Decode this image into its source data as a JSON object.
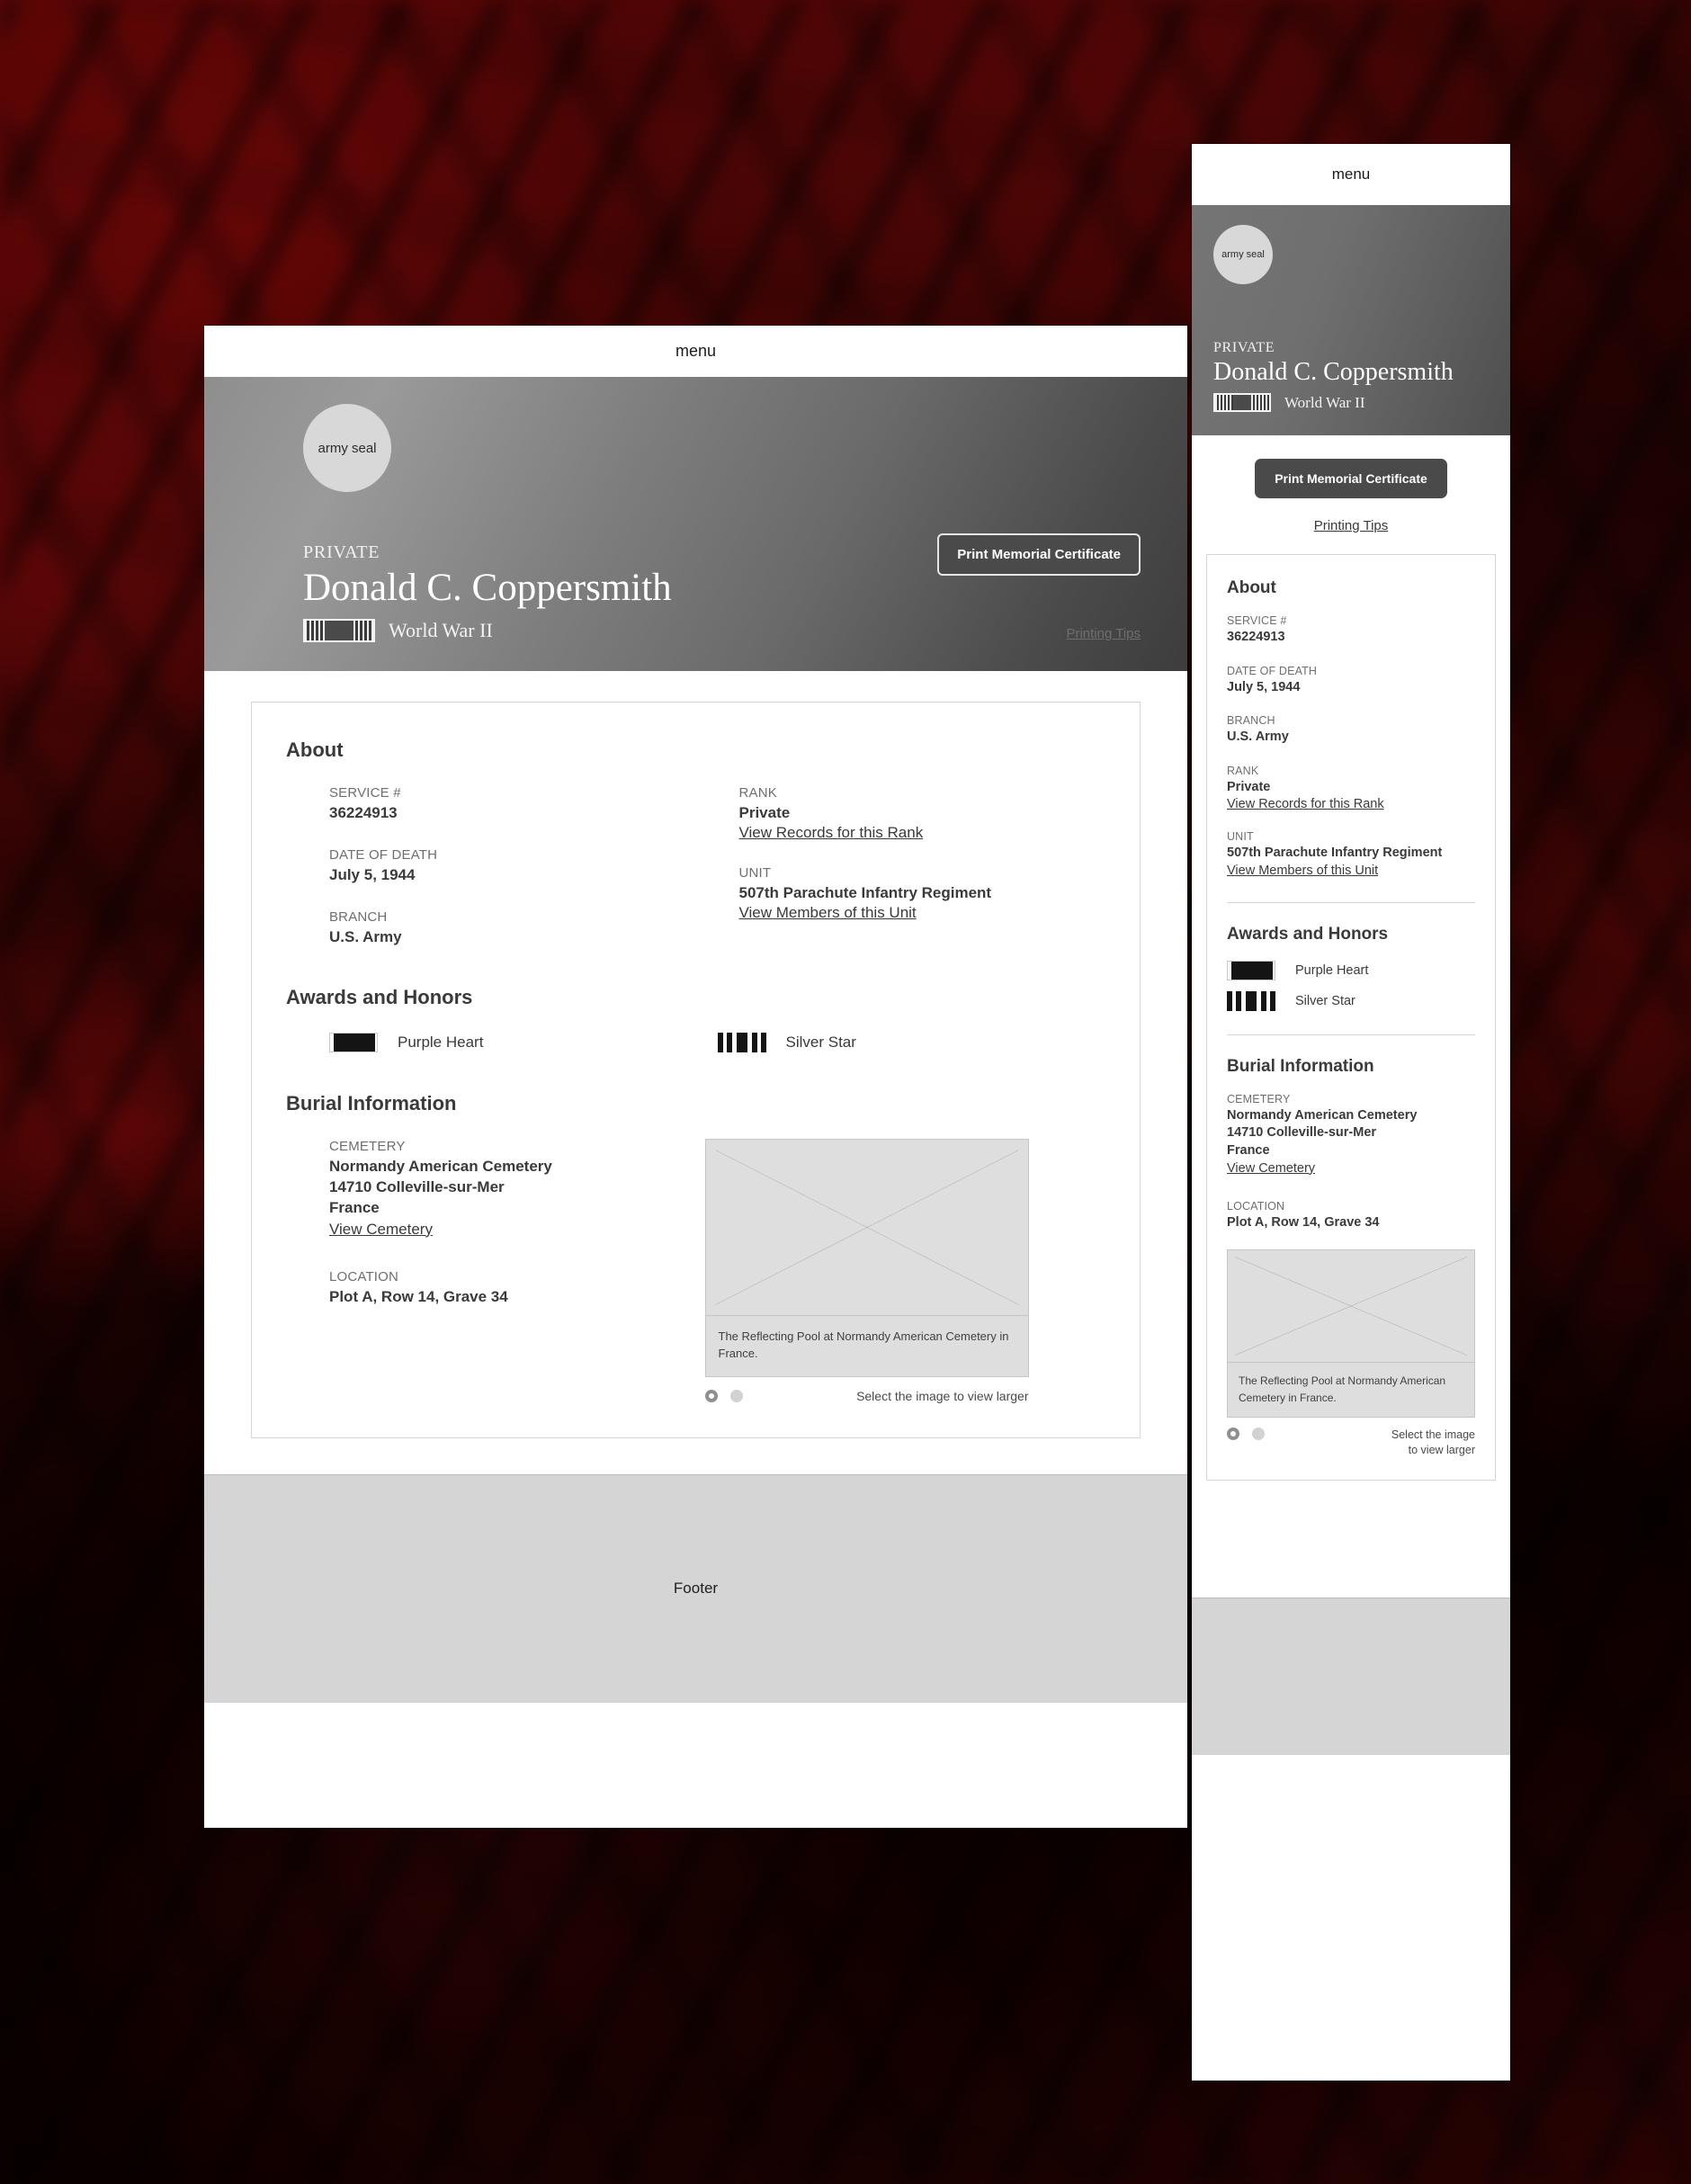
{
  "colors": {
    "backdrop_red": "#5a0505",
    "hero_gray_start": "#8e8e8e",
    "hero_gray_end": "#3d3d3d",
    "button_dark": "#4a4a4a",
    "footer_gray": "#d5d5d5",
    "card_border": "#d6d6d6",
    "text_dark": "#3a3a3a",
    "text_muted": "#6e6e6e",
    "placeholder_fill": "#dedede"
  },
  "nav": {
    "menu_label": "menu"
  },
  "hero": {
    "seal_label": "army seal",
    "rank_eyebrow": "PRIVATE",
    "name": "Donald C. Coppersmith",
    "conflict": "World War II",
    "conflict_ribbon": "wwii-service-ribbon"
  },
  "actions": {
    "print_label": "Print Memorial Certificate",
    "printing_tips_label": "Printing Tips"
  },
  "about": {
    "title": "About",
    "fields": [
      {
        "label": "SERVICE #",
        "value": "36224913"
      },
      {
        "label": "DATE OF DEATH",
        "value": "July 5, 1944"
      },
      {
        "label": "BRANCH",
        "value": "U.S. Army"
      },
      {
        "label": "RANK",
        "value": "Private",
        "link": "View Records for this Rank"
      },
      {
        "label": "UNIT",
        "value": "507th Parachute Infantry Regiment",
        "link": "View Members of this Unit"
      }
    ]
  },
  "awards": {
    "title": "Awards and Honors",
    "items": [
      {
        "name": "Purple Heart",
        "ribbon": "purple-heart-ribbon"
      },
      {
        "name": "Silver Star",
        "ribbon": "silver-star-ribbon"
      }
    ]
  },
  "burial": {
    "title": "Burial Information",
    "cemetery_label": "CEMETERY",
    "cemetery_line1": "Normandy American Cemetery",
    "cemetery_line2": "14710 Colleville-sur-Mer",
    "cemetery_line3": "France",
    "cemetery_link": "View Cemetery",
    "location_label": "LOCATION",
    "location_value": "Plot A, Row 14, Grave 34"
  },
  "gallery": {
    "caption": "The Reflecting Pool at Normandy American Cemetery in France.",
    "hint": "Select the image to view larger",
    "hint_mobile_line1": "Select the image",
    "hint_mobile_line2": "to view larger",
    "slide_count": 2,
    "active_slide": 1
  },
  "footer": {
    "label": "Footer"
  }
}
